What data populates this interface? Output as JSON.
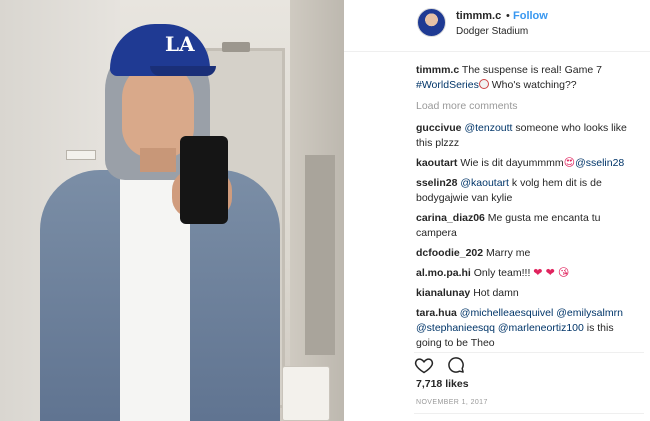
{
  "post": {
    "username": "timmm.c",
    "separator": "•",
    "follow_label": "Follow",
    "location": "Dodger Stadium",
    "cap_logo": "LA"
  },
  "caption": {
    "user": "timmm.c",
    "text_before": " The suspense is real! Game 7",
    "hashtag": "#WorldSeries",
    "text_after": " Who's watching??"
  },
  "load_more": "Load more comments",
  "comments": [
    {
      "user": "guccivue",
      "parts": [
        {
          "link": "@tenzoutt"
        },
        {
          "text": " someone who looks like this plzzz"
        }
      ]
    },
    {
      "user": "kaoutart",
      "parts": [
        {
          "text": " Wie is dit dayummmm"
        },
        {
          "link": "@sselin28"
        }
      ]
    },
    {
      "user": "sselin28",
      "parts": [
        {
          "link": "@kaoutart"
        },
        {
          "text": " k volg hem dit is de bodygajwie van kylie"
        }
      ]
    },
    {
      "user": "carina_diaz06",
      "parts": [
        {
          "text": " Me gusta me encanta tu campera"
        }
      ]
    },
    {
      "user": "dcfoodie_202",
      "parts": [
        {
          "text": " Marry me"
        }
      ]
    },
    {
      "user": "al.mo.pa.hi",
      "parts": [
        {
          "text": " Only team!!! "
        }
      ]
    },
    {
      "user": "kianalunay",
      "parts": [
        {
          "text": " Hot damn"
        }
      ]
    },
    {
      "user": "tara.hua",
      "parts": [
        {
          "link": "@michelleaesquivel"
        },
        {
          "text": " "
        },
        {
          "link": "@emilysalmrn"
        },
        {
          "text": " "
        },
        {
          "link": "@stephanieesqq"
        },
        {
          "text": " "
        },
        {
          "link": "@marleneortiz100"
        },
        {
          "text": " is this going to be Theo"
        }
      ]
    }
  ],
  "likes": "7,718 likes",
  "date": "NOVEMBER 1, 2017",
  "icons": {
    "like": "heart-outline-icon",
    "comment": "speech-bubble-icon"
  },
  "colors": {
    "link": "#003569",
    "follow": "#3897f0",
    "muted": "#999999",
    "text": "#262626"
  }
}
